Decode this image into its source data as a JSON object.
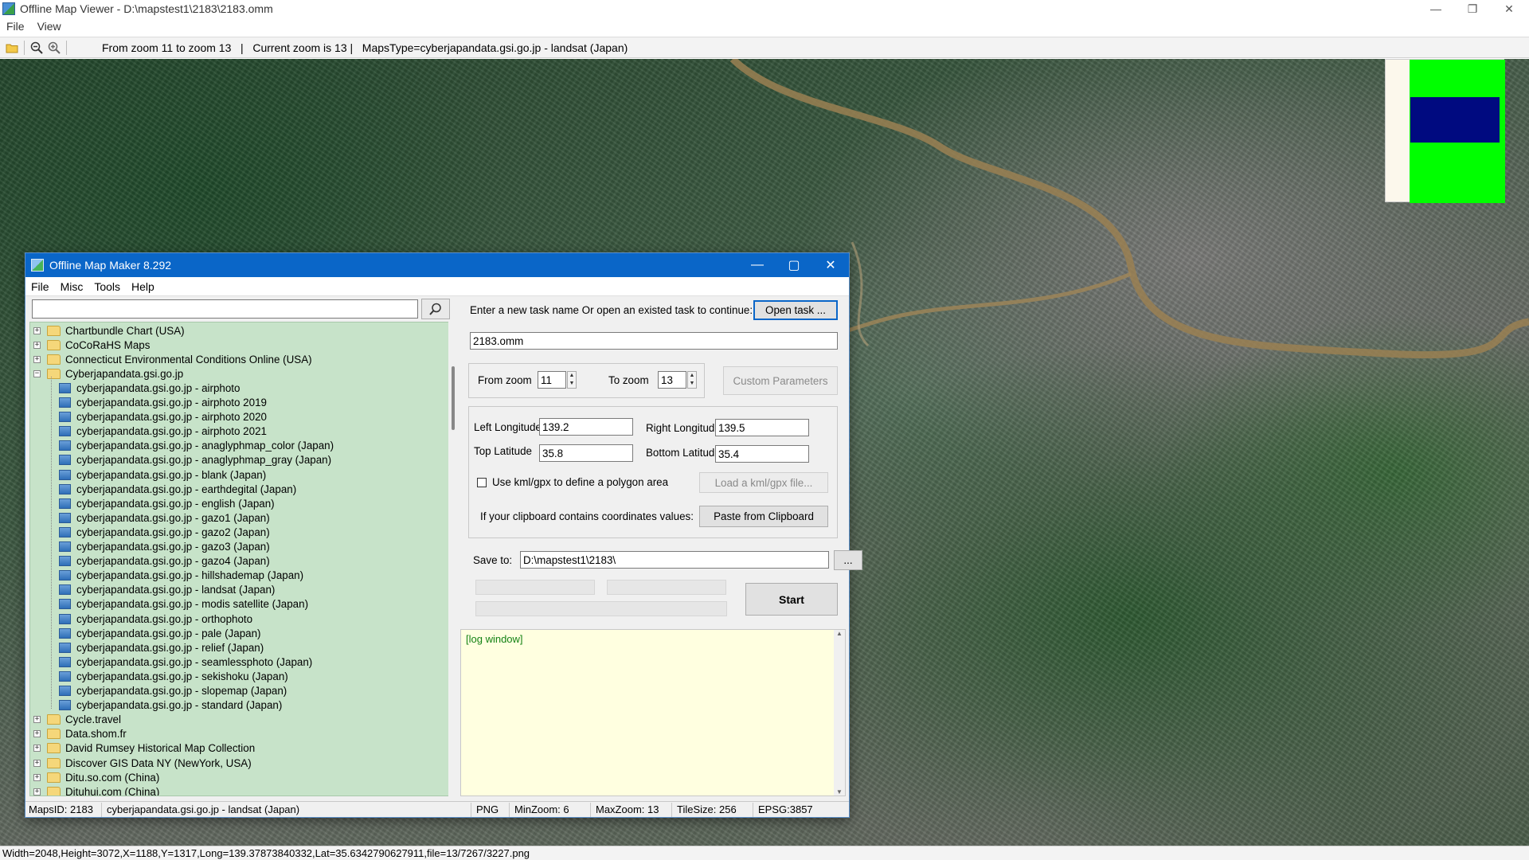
{
  "window": {
    "title": "Offline Map Viewer - D:\\mapstest1\\2183\\2183.omm",
    "minimize": "—",
    "maximize": "❐",
    "close": "✕"
  },
  "menu": [
    "File",
    "View"
  ],
  "toolbar": {
    "info": "From zoom 11 to zoom 13   |   Current zoom is 13 |   MapsType=cyberjapandata.gsi.go.jp - landsat (Japan)"
  },
  "status_bar": "Width=2048,Height=3072,X=1188,Y=1317,Long=139.37873840332,Lat=35.6342790627911,file=13/7267/3227.png",
  "dialog": {
    "title": "Offline Map Maker 8.292",
    "menu": [
      "File",
      "Misc",
      "Tools",
      "Help"
    ],
    "search_placeholder": "",
    "tree": [
      {
        "label": "Chartbundle Chart (USA)",
        "level": 0,
        "type": "folder",
        "expander": "+"
      },
      {
        "label": "CoCoRaHS Maps",
        "level": 0,
        "type": "folder",
        "expander": "+"
      },
      {
        "label": "Connecticut Environmental Conditions Online (USA)",
        "level": 0,
        "type": "folder",
        "expander": "+"
      },
      {
        "label": "Cyberjapandata.gsi.go.jp",
        "level": 0,
        "type": "folder",
        "expander": "−"
      },
      {
        "label": "cyberjapandata.gsi.go.jp - airphoto",
        "level": 1,
        "type": "map"
      },
      {
        "label": "cyberjapandata.gsi.go.jp - airphoto 2019",
        "level": 1,
        "type": "map"
      },
      {
        "label": "cyberjapandata.gsi.go.jp - airphoto 2020",
        "level": 1,
        "type": "map"
      },
      {
        "label": "cyberjapandata.gsi.go.jp - airphoto 2021",
        "level": 1,
        "type": "map"
      },
      {
        "label": "cyberjapandata.gsi.go.jp - anaglyphmap_color (Japan)",
        "level": 1,
        "type": "map"
      },
      {
        "label": "cyberjapandata.gsi.go.jp - anaglyphmap_gray (Japan)",
        "level": 1,
        "type": "map"
      },
      {
        "label": "cyberjapandata.gsi.go.jp - blank (Japan)",
        "level": 1,
        "type": "map"
      },
      {
        "label": "cyberjapandata.gsi.go.jp - earthdegital (Japan)",
        "level": 1,
        "type": "map"
      },
      {
        "label": "cyberjapandata.gsi.go.jp - english (Japan)",
        "level": 1,
        "type": "map"
      },
      {
        "label": "cyberjapandata.gsi.go.jp - gazo1 (Japan)",
        "level": 1,
        "type": "map"
      },
      {
        "label": "cyberjapandata.gsi.go.jp - gazo2 (Japan)",
        "level": 1,
        "type": "map"
      },
      {
        "label": "cyberjapandata.gsi.go.jp - gazo3 (Japan)",
        "level": 1,
        "type": "map"
      },
      {
        "label": "cyberjapandata.gsi.go.jp - gazo4 (Japan)",
        "level": 1,
        "type": "map"
      },
      {
        "label": "cyberjapandata.gsi.go.jp - hillshademap (Japan)",
        "level": 1,
        "type": "map"
      },
      {
        "label": "cyberjapandata.gsi.go.jp - landsat (Japan)",
        "level": 1,
        "type": "map"
      },
      {
        "label": "cyberjapandata.gsi.go.jp - modis satellite (Japan)",
        "level": 1,
        "type": "map"
      },
      {
        "label": "cyberjapandata.gsi.go.jp - orthophoto",
        "level": 1,
        "type": "map"
      },
      {
        "label": "cyberjapandata.gsi.go.jp - pale (Japan)",
        "level": 1,
        "type": "map"
      },
      {
        "label": "cyberjapandata.gsi.go.jp - relief (Japan)",
        "level": 1,
        "type": "map"
      },
      {
        "label": "cyberjapandata.gsi.go.jp - seamlessphoto (Japan)",
        "level": 1,
        "type": "map"
      },
      {
        "label": "cyberjapandata.gsi.go.jp - sekishoku (Japan)",
        "level": 1,
        "type": "map"
      },
      {
        "label": "cyberjapandata.gsi.go.jp - slopemap (Japan)",
        "level": 1,
        "type": "map"
      },
      {
        "label": "cyberjapandata.gsi.go.jp - standard (Japan)",
        "level": 1,
        "type": "map"
      },
      {
        "label": "Cycle.travel",
        "level": 0,
        "type": "folder",
        "expander": "+"
      },
      {
        "label": "Data.shom.fr",
        "level": 0,
        "type": "folder",
        "expander": "+"
      },
      {
        "label": "David Rumsey Historical Map Collection",
        "level": 0,
        "type": "folder",
        "expander": "+"
      },
      {
        "label": "Discover GIS Data NY (NewYork, USA)",
        "level": 0,
        "type": "folder",
        "expander": "+"
      },
      {
        "label": "Ditu.so.com (China)",
        "level": 0,
        "type": "folder",
        "expander": "+"
      },
      {
        "label": "Dituhui.com (China)",
        "level": 0,
        "type": "folder",
        "expander": "+"
      }
    ],
    "task_prompt": "Enter a new task name Or open an existed task to continue:",
    "open_task_label": "Open task ...",
    "task_name": "2183.omm",
    "from_zoom_label": "From zoom",
    "from_zoom": "11",
    "to_zoom_label": "To zoom",
    "to_zoom": "13",
    "custom_params_label": "Custom Parameters",
    "left_lon_label": "Left Longitude",
    "left_lon": "139.2",
    "right_lon_label": "Right Longitude",
    "right_lon": "139.5",
    "top_lat_label": "Top Latitude",
    "top_lat": "35.8",
    "bottom_lat_label": "Bottom Latitude",
    "bottom_lat": "35.4",
    "kml_label": "Use kml/gpx to define a polygon area",
    "kml_checked": false,
    "load_kml_label": "Load a kml/gpx file...",
    "clipboard_prompt": "If your clipboard contains coordinates values:",
    "paste_label": "Paste from Clipboard",
    "save_to_label": "Save to:",
    "save_to": "D:\\mapstest1\\2183\\",
    "browse_label": "...",
    "start_label": "Start",
    "log_text": "[log window]",
    "status": {
      "maps_id": "MapsID: 2183",
      "maps_name": "cyberjapandata.gsi.go.jp - landsat (Japan)",
      "format": "PNG",
      "min_zoom": "MinZoom: 6",
      "max_zoom": "MaxZoom: 13",
      "tile_size": "TileSize: 256",
      "epsg": "EPSG:3857"
    }
  },
  "colors": {
    "dialog_title_bg": "#0a66c8",
    "tree_bg": "#c7e3c9",
    "log_bg": "#ffffe0",
    "log_text": "#148214",
    "overview_green": "#00ff00",
    "overview_blue": "#000a80"
  }
}
